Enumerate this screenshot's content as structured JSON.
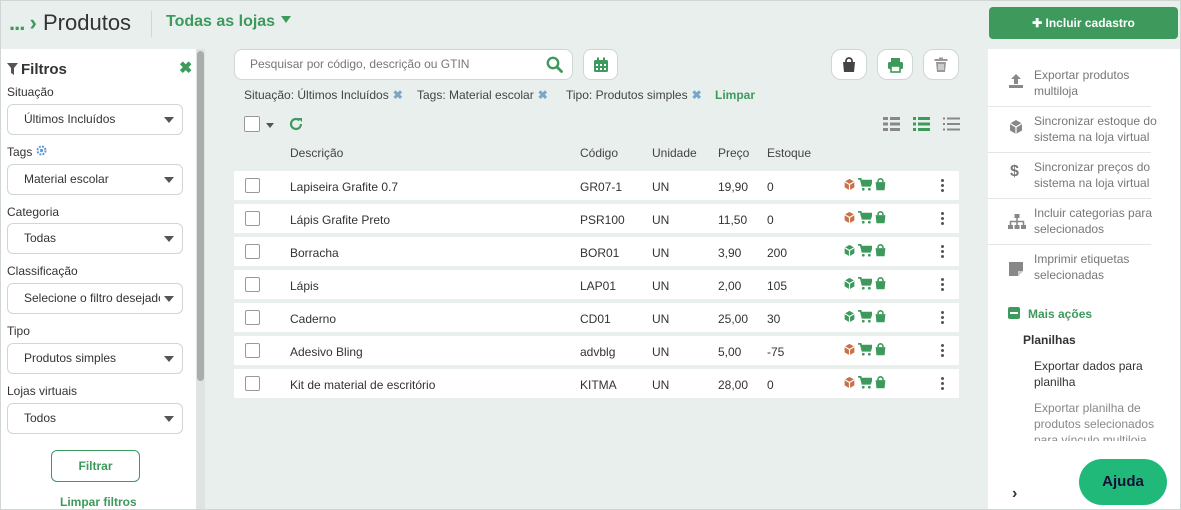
{
  "header": {
    "breadcrumb": "...",
    "title": "Produtos",
    "store_selector": "Todas as lojas",
    "add_button": "Incluir cadastro"
  },
  "filters": {
    "title": "Filtros",
    "groups": [
      {
        "label": "Situação",
        "value": "Últimos Incluídos"
      },
      {
        "label": "Tags",
        "value": "Material escolar"
      },
      {
        "label": "Categoria",
        "value": "Todas"
      },
      {
        "label": "Classificação",
        "value": "Selecione o filtro desejado"
      },
      {
        "label": "Tipo",
        "value": "Produtos simples"
      },
      {
        "label": "Lojas virtuais",
        "value": "Todos"
      }
    ],
    "apply_button": "Filtrar",
    "clear_link": "Limpar filtros"
  },
  "search": {
    "placeholder": "Pesquisar por código, descrição ou GTIN"
  },
  "active_filters": [
    "Situação: Últimos Incluídos",
    "Tags: Material escolar",
    "Tipo: Produtos simples"
  ],
  "clear_active": "Limpar",
  "table": {
    "columns": [
      "Descrição",
      "Código",
      "Unidade",
      "Preço",
      "Estoque"
    ],
    "rows": [
      {
        "descricao": "Lapiseira Grafite 0.7",
        "codigo": "GR07-1",
        "unidade": "UN",
        "preco": "19,90",
        "estoque": "0",
        "box_color": "#c9714a"
      },
      {
        "descricao": "Lápis Grafite Preto",
        "codigo": "PSR100",
        "unidade": "UN",
        "preco": "11,50",
        "estoque": "0",
        "box_color": "#c9714a"
      },
      {
        "descricao": "Borracha",
        "codigo": "BOR01",
        "unidade": "UN",
        "preco": "3,90",
        "estoque": "200",
        "box_color": "#3d9a5c"
      },
      {
        "descricao": "Lápis",
        "codigo": "LAP01",
        "unidade": "UN",
        "preco": "2,00",
        "estoque": "105",
        "box_color": "#3d9a5c"
      },
      {
        "descricao": "Caderno",
        "codigo": "CD01",
        "unidade": "UN",
        "preco": "25,00",
        "estoque": "30",
        "box_color": "#3d9a5c"
      },
      {
        "descricao": "Adesivo Bling",
        "codigo": "advblg",
        "unidade": "UN",
        "preco": "5,00",
        "estoque": "-75",
        "box_color": "#c9714a"
      },
      {
        "descricao": "Kit de material de escritório",
        "codigo": "KITMA",
        "unidade": "UN",
        "preco": "28,00",
        "estoque": "0",
        "box_color": "#c9714a"
      }
    ]
  },
  "right_panel": {
    "actions": [
      {
        "icon": "upload-icon",
        "label": "Exportar produtos multiloja"
      },
      {
        "icon": "cube-icon",
        "label": "Sincronizar estoque do sistema na loja virtual"
      },
      {
        "icon": "dollar-icon",
        "label": "Sincronizar preços do sistema na loja virtual"
      },
      {
        "icon": "sitemap-icon",
        "label": "Incluir categorias para selecionados"
      },
      {
        "icon": "tag-icon",
        "label": "Imprimir etiquetas selecionadas"
      }
    ],
    "more_actions": "Mais ações",
    "planilhas_title": "Planilhas",
    "planilhas": [
      {
        "label": "Exportar dados para planilha"
      },
      {
        "label": "Exportar planilha de produtos selecionados para vínculo multiloja"
      }
    ]
  },
  "help_button": "Ajuda",
  "colors": {
    "accent": "#3d9a5c",
    "help": "#20b97a",
    "stock_out": "#c9714a"
  }
}
